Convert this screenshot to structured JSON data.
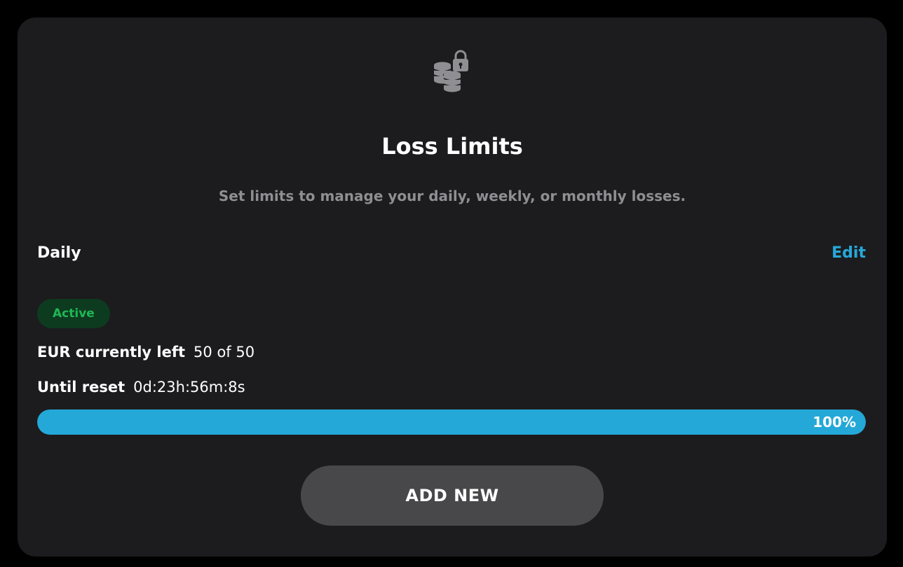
{
  "header": {
    "icon": "coins-lock-icon",
    "title": "Loss Limits",
    "subtitle": "Set limits to manage your daily, weekly, or monthly losses."
  },
  "limit": {
    "period": "Daily",
    "edit_label": "Edit",
    "status": "Active",
    "remaining_label": "EUR currently left",
    "remaining_value": "50 of 50",
    "reset_label": "Until reset",
    "reset_value": "0d:23h:56m:8s",
    "progress_percent": 100,
    "progress_text": "100%"
  },
  "actions": {
    "add_new_label": "ADD NEW"
  },
  "colors": {
    "background": "#000000",
    "card": "#1c1c1e",
    "accent": "#24a8d8",
    "active_text": "#1fb656",
    "active_bg": "#0d3b1f",
    "muted_text": "#8e8e93",
    "button_bg": "#48484a"
  }
}
